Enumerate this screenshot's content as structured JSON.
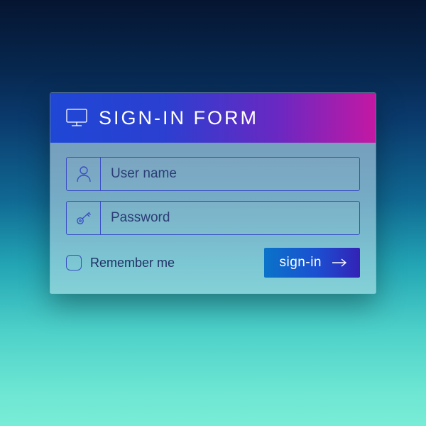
{
  "header": {
    "title": "SIGN-IN FORM"
  },
  "fields": {
    "username": {
      "placeholder": "User name",
      "value": ""
    },
    "password": {
      "placeholder": "Password",
      "value": ""
    }
  },
  "remember": {
    "label": "Remember me",
    "checked": false
  },
  "submit": {
    "label": "sign-in"
  },
  "colors": {
    "accent_gradient_start": "#1f47d6",
    "accent_gradient_end": "#c418a3",
    "field_border": "#3a4fc4",
    "button_start": "#0a73c9",
    "button_end": "#3322b6"
  }
}
